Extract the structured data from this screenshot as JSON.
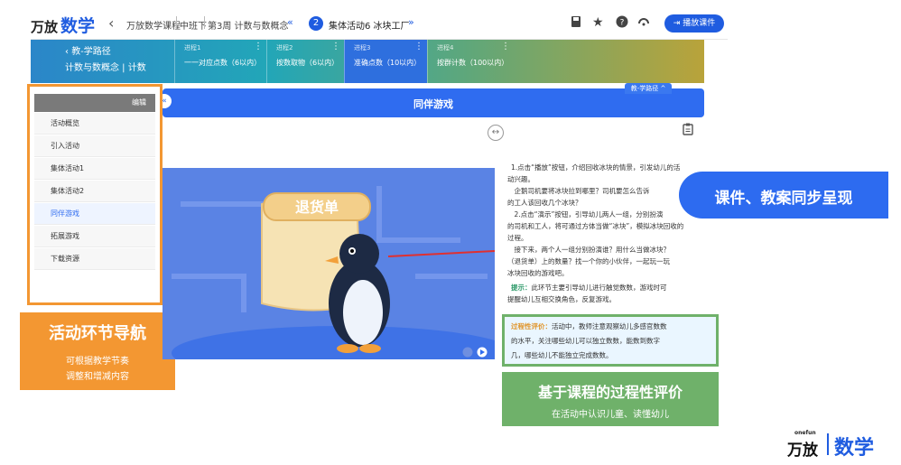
{
  "app": {
    "logo_left": "万放",
    "logo_right": "数学",
    "breadcrumbs": [
      "万放数学课程",
      "中班下",
      "第3周 计数与数概念"
    ],
    "session_number": "2",
    "session_title": "集体活动6 冰块工厂",
    "play_label": "播放课件"
  },
  "path_panel": {
    "back_label": "教-学路径",
    "subtitle": "计数与数概念 | 计数",
    "tab_label": "教-学路径"
  },
  "steps": [
    {
      "num": "进程1",
      "title": "一一对应点数（6以内）"
    },
    {
      "num": "进程2",
      "title": "按数取物（6以内）"
    },
    {
      "num": "进程3",
      "title": "准确点数（10以内）"
    },
    {
      "num": "进程4",
      "title": "按群计数（100以内）"
    }
  ],
  "sidebar": {
    "edit_label": "编辑",
    "items": [
      {
        "label": "活动概览"
      },
      {
        "label": "引入活动"
      },
      {
        "label": "集体活动1"
      },
      {
        "label": "集体活动2"
      },
      {
        "label": "同伴游戏"
      },
      {
        "label": "拓展游戏"
      },
      {
        "label": "下载资源"
      }
    ]
  },
  "game": {
    "title": "同伴游戏",
    "scroll_text": "退货单"
  },
  "lesson": {
    "lines": [
      "1.点击“播放”按钮，介绍回收冰块的情景，引发幼儿的活",
      "动兴趣。",
      "　企鹅司机要将冰块拉到哪里？司机要怎么告诉",
      "的工人该回收几个冰块？",
      "　2.点击“演示”按钮，引导幼儿两人一组，分别扮演",
      "的司机和工人，将可通过方体当做“冰块”，模拟冰块回收的",
      "过程。",
      "　接下来，两个人一组分别扮演谁？用什么当做冰块？",
      "（退货单）上的数量？找一个你的小伙伴，一起玩一玩",
      "冰块回收的游戏吧。"
    ],
    "tip_label": "提示：",
    "tip_lines": [
      "此环节主要引导幼儿进行触觉数数，游戏时可",
      "提醒幼儿互相交换角色，反复游戏。"
    ],
    "eval_label": "过程性评价：",
    "eval_lines": [
      "活动中，教师注意观察幼儿多感官数数",
      "的水平，关注哪些幼儿可以独立数数，能数到数字",
      "几，哪些幼儿不能独立完成数数。"
    ]
  },
  "annotations": {
    "nav_title": "活动环节导航",
    "nav_desc_1": "可根据教学节奏",
    "nav_desc_2": "调整和增减内容",
    "callout": "课件、教案同步呈现",
    "eval_title": "基于课程的过程性评价",
    "eval_desc": "在活动中认识儿童、读懂幼儿"
  },
  "brand": {
    "small": "onefun",
    "name": "万放",
    "subject": "数学"
  },
  "colors": {
    "primary": "#2f6cf0",
    "nav_orange": "#f39732",
    "eval_green": "#6fb16a",
    "arrow_red": "#e03030"
  }
}
